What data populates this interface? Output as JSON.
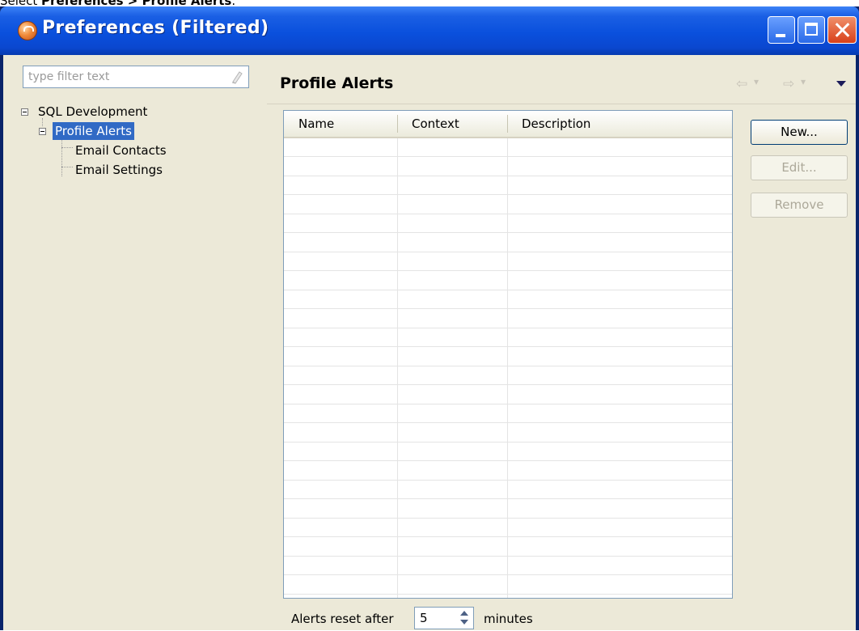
{
  "caption": {
    "prefix": "Select ",
    "bold": "Preferences > Profile Alerts",
    "suffix": "."
  },
  "window": {
    "title": "Preferences (Filtered)"
  },
  "filter": {
    "placeholder": "type filter text",
    "value": ""
  },
  "tree": {
    "items": [
      {
        "label": "SQL Development",
        "expanded": true,
        "selected": false
      },
      {
        "label": "Profile Alerts",
        "expanded": true,
        "selected": true
      },
      {
        "label": "Email Contacts",
        "selected": false
      },
      {
        "label": "Email Settings",
        "selected": false
      }
    ]
  },
  "page": {
    "title": "Profile Alerts"
  },
  "table": {
    "columns": [
      "Name",
      "Context",
      "Description"
    ],
    "rows": []
  },
  "buttons": {
    "new": "New...",
    "edit": "Edit...",
    "remove": "Remove"
  },
  "footer": {
    "label": "Alerts reset after",
    "value": "5",
    "unit": "minutes"
  },
  "colors": {
    "title_bar": "#0a50dd",
    "selection": "#316ac5",
    "dialog_bg": "#ece9d8"
  }
}
